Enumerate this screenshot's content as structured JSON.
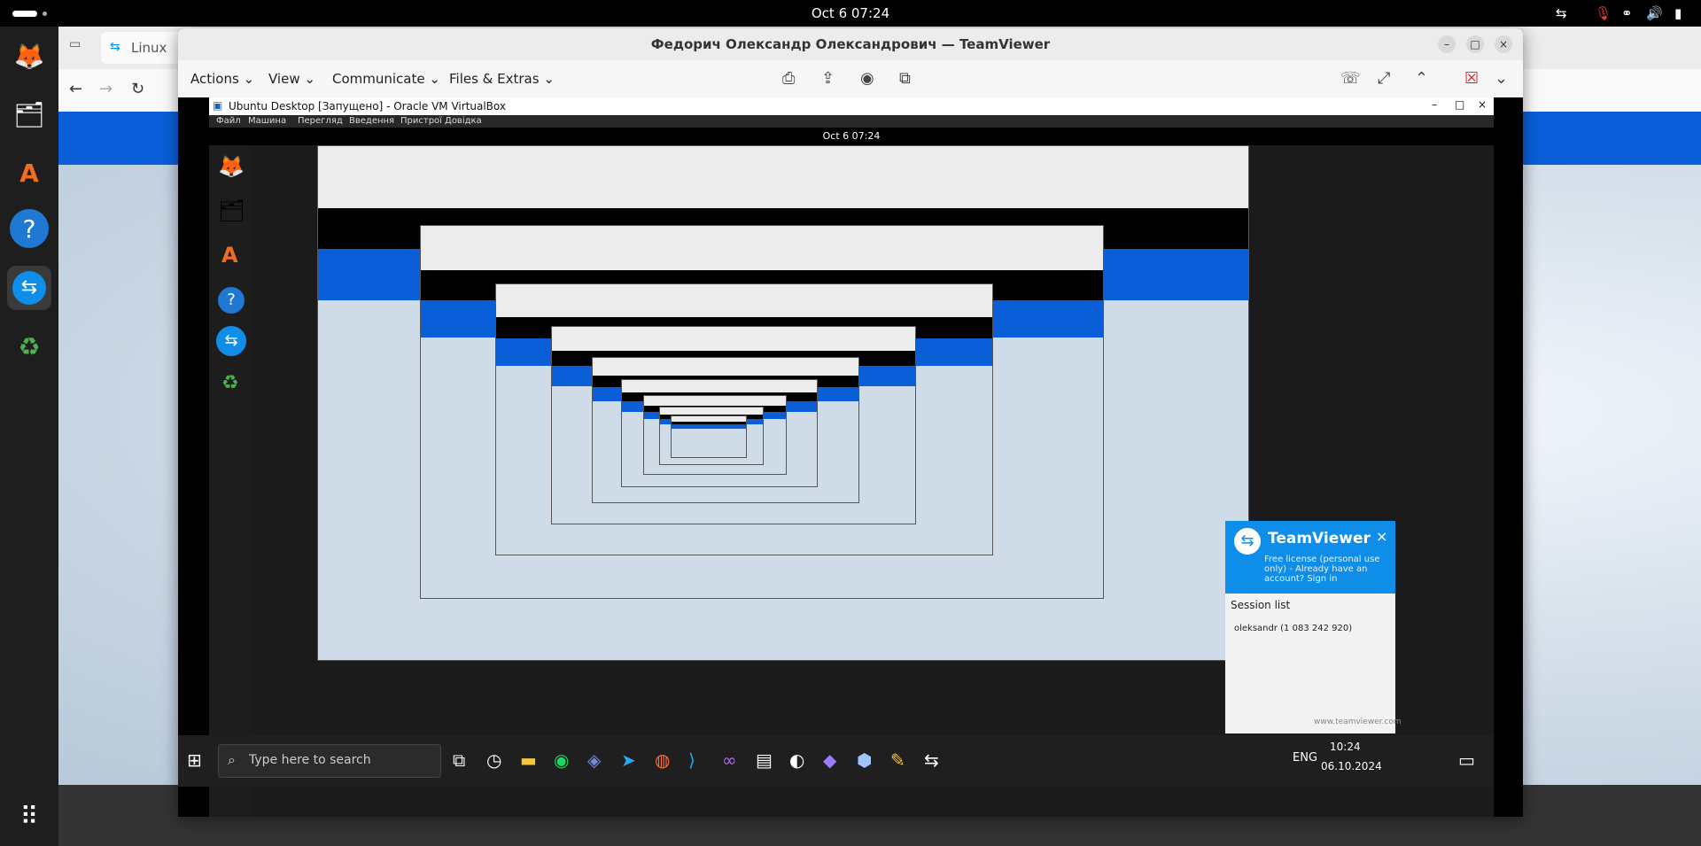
{
  "topbar": {
    "clock": "Oct 6  07:24"
  },
  "dock": {
    "items": [
      {
        "name": "firefox-icon",
        "glyph": "🦊"
      },
      {
        "name": "files-icon",
        "glyph": "🗂"
      },
      {
        "name": "app-center-icon",
        "glyph": "A"
      },
      {
        "name": "help-icon",
        "glyph": "?"
      },
      {
        "name": "teamviewer-icon",
        "glyph": "⇆"
      },
      {
        "name": "trash-icon",
        "glyph": "♻"
      }
    ],
    "show_apps_glyph": "⠿"
  },
  "bg_browser": {
    "tab_label": "Linux"
  },
  "teamviewer": {
    "title": "Федорич Олександр Олександрович — TeamViewer",
    "menus": [
      "Actions",
      "View",
      "Communicate",
      "Files & Extras"
    ]
  },
  "virtualbox": {
    "title": "Ubuntu Desktop [Запущено] - Oracle VM VirtualBox",
    "menu": [
      "Файл",
      "Машина",
      "Перегляд",
      "Введення",
      "Пристрої",
      "Довідка"
    ]
  },
  "vm": {
    "clock": "Oct 6  07:24"
  },
  "windows_taskbar": {
    "search_placeholder": "Type here to search",
    "lang": "ENG",
    "time": "10:24",
    "date": "06.10.2024"
  },
  "tv_panel": {
    "brand": "TeamViewer",
    "subtitle": "Free license (personal use only) - Already have an account? Sign in",
    "session_list_title": "Session list",
    "session_entry": "oleksandr (1 083 242 920)",
    "footer": "www.teamviewer.com"
  }
}
